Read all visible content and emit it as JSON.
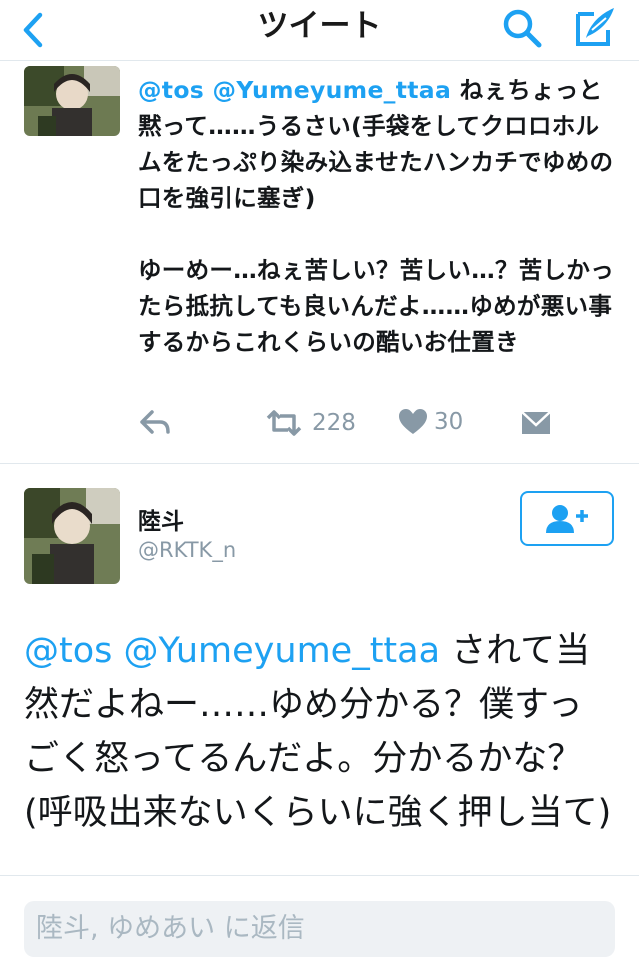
{
  "header": {
    "title": "ツイート",
    "back_icon": "chevron-left-icon",
    "search_icon": "search-icon",
    "compose_icon": "compose-icon"
  },
  "reply_tweet": {
    "mentions": "@tos @Yumeyume_ttaa",
    "text_1": " ねぇちょっと黙って……うるさい(手袋をしてクロロホルムをたっぷり染み込ませたハンカチでゆめの口を強引に塞ぎ)",
    "text_2": "ゆーめー…ねぇ苦しい？苦しい…？苦しかったら抵抗しても良いんだよ……ゆめが悪い事するからこれくらいの酷いお仕置き",
    "retweet_count": "228",
    "like_count": "30"
  },
  "focused_tweet": {
    "name": "陸斗",
    "handle": "@RKTK_n",
    "mentions": "@tos @Yumeyume_ttaa",
    "text": " されて当然だよねー……ゆめ分かる？僕すっごく怒ってるんだよ。分かるかな？(呼吸出来ないくらいに強く押し当て)"
  },
  "reply_bar": {
    "placeholder": "陸斗, ゆめあい に返信"
  },
  "colors": {
    "accent": "#1da1f2",
    "muted": "#8899a6"
  }
}
